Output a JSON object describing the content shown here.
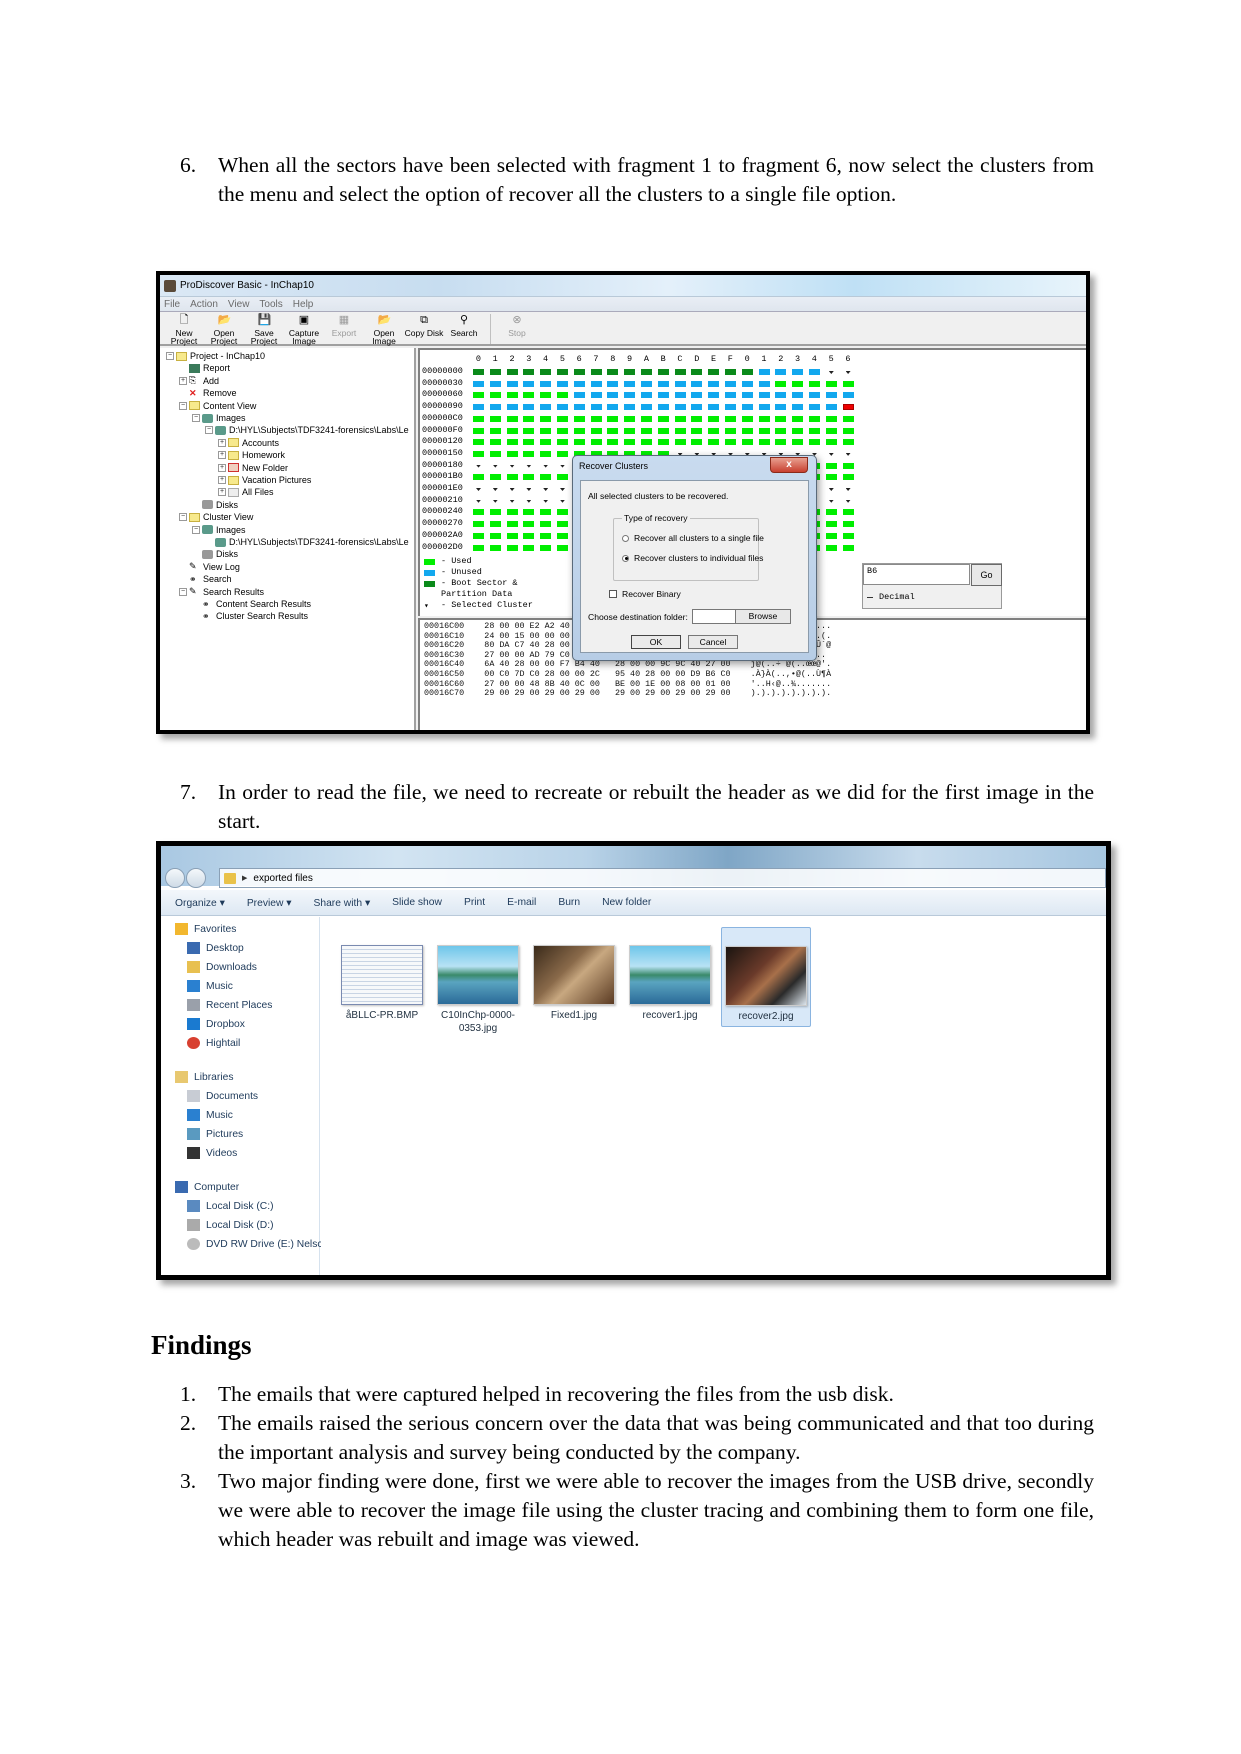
{
  "steps": [
    {
      "number": "6.",
      "text": "When all the sectors have been selected with fragment 1 to fragment 6, now select the clusters from the menu and select the option of recover all the clusters to a single file option."
    },
    {
      "number": "7.",
      "text": "In order to read the file, we need to recreate or rebuilt the header as we did for the first image in the start."
    }
  ],
  "prodiscover": {
    "window_title": "ProDiscover Basic - InChap10",
    "menu": [
      "File",
      "Action",
      "View",
      "Tools",
      "Help"
    ],
    "toolbar": [
      {
        "icon": "new-project-icon",
        "label": "New Project",
        "enabled": true
      },
      {
        "icon": "open-project-icon",
        "label": "Open Project",
        "enabled": true
      },
      {
        "icon": "save-project-icon",
        "label": "Save Project",
        "enabled": true
      },
      {
        "icon": "capture-image-icon",
        "label": "Capture Image",
        "enabled": true
      },
      {
        "icon": "export-icon",
        "label": "Export",
        "enabled": false
      },
      {
        "icon": "open-image-icon",
        "label": "Open Image",
        "enabled": true
      },
      {
        "icon": "copy-disk-icon",
        "label": "Copy Disk",
        "enabled": true
      },
      {
        "icon": "search-icon",
        "label": "Search",
        "enabled": true
      },
      {
        "icon": "stop-icon",
        "label": "Stop",
        "enabled": false
      }
    ],
    "tree": [
      {
        "level": 0,
        "expander": "-",
        "icon": "folder",
        "label": "Project - InChap10"
      },
      {
        "level": 1,
        "expander": "",
        "icon": "report",
        "label": "Report"
      },
      {
        "level": 1,
        "expander": "+",
        "icon": "add",
        "label": "Add"
      },
      {
        "level": 1,
        "expander": "",
        "icon": "remove",
        "label": "Remove"
      },
      {
        "level": 1,
        "expander": "-",
        "icon": "folder",
        "label": "Content View"
      },
      {
        "level": 2,
        "expander": "-",
        "icon": "disk",
        "label": "Images"
      },
      {
        "level": 3,
        "expander": "-",
        "icon": "disk",
        "label": "D:\\HYL\\Subjects\\TDF3241-forensics\\Labs\\Le"
      },
      {
        "level": 4,
        "expander": "+",
        "icon": "folder",
        "label": "Accounts"
      },
      {
        "level": 4,
        "expander": "+",
        "icon": "folder",
        "label": "Homework"
      },
      {
        "level": 4,
        "expander": "+",
        "icon": "folder-deleted",
        "label": "New Folder"
      },
      {
        "level": 4,
        "expander": "+",
        "icon": "folder",
        "label": "Vacation Pictures"
      },
      {
        "level": 4,
        "expander": "+",
        "icon": "folder-gray",
        "label": "All Files"
      },
      {
        "level": 2,
        "expander": "",
        "icon": "drive",
        "label": "Disks"
      },
      {
        "level": 1,
        "expander": "-",
        "icon": "folder",
        "label": "Cluster View"
      },
      {
        "level": 2,
        "expander": "-",
        "icon": "disk",
        "label": "Images"
      },
      {
        "level": 3,
        "expander": "",
        "icon": "disk",
        "label": "D:\\HYL\\Subjects\\TDF3241-forensics\\Labs\\Le"
      },
      {
        "level": 2,
        "expander": "",
        "icon": "drive",
        "label": "Disks"
      },
      {
        "level": 1,
        "expander": "",
        "icon": "log",
        "label": "View Log"
      },
      {
        "level": 1,
        "expander": "",
        "icon": "binoculars",
        "label": "Search"
      },
      {
        "level": 1,
        "expander": "-",
        "icon": "log",
        "label": "Search Results"
      },
      {
        "level": 2,
        "expander": "",
        "icon": "binoculars",
        "label": "Content Search Results"
      },
      {
        "level": 2,
        "expander": "",
        "icon": "binoculars",
        "label": "Cluster Search Results"
      }
    ],
    "cluster_grid": {
      "column_headers": [
        "0",
        "1",
        "2",
        "3",
        "4",
        "5",
        "6",
        "7",
        "8",
        "9",
        "A",
        "B",
        "C",
        "D",
        "E",
        "F",
        "0",
        "1",
        "2",
        "3",
        "4",
        "5",
        "6"
      ],
      "row_addresses": [
        "00000000",
        "00000030",
        "00000060",
        "00000090",
        "000000C0",
        "000000F0",
        "00000120",
        "00000150",
        "00000180",
        "000001B0",
        "000001E0",
        "00000210",
        "00000240",
        "00000270",
        "000002A0",
        "000002D0"
      ],
      "legend": [
        {
          "state": "used",
          "label": "- Used"
        },
        {
          "state": "unused",
          "label": "- Unused"
        },
        {
          "state": "boot",
          "label": "- Boot Sector &"
        },
        {
          "state": "",
          "label": "  Partition Data"
        },
        {
          "state": "sel",
          "label": "- Selected Cluster"
        }
      ],
      "colors": {
        "used": "#00ee00",
        "unused": "#12a8ee",
        "boot": "#0a8a1a",
        "bad": "#ee0000"
      }
    },
    "goto": {
      "value": "B6",
      "go_label": "Go",
      "decimal_label": "Decimal"
    },
    "hex_dump": [
      "00016C00    28 00 00 E2 A2 40 40 00   00 00 00 00 00 00 00 00    (..âḉ@@.........",
      "00016C10    24 00 15 00 00 00 00 00   00 00 00 00 00 00 28 28    $.............(.",
      "00016C20    80 DA C7 40 28 00 00 DA   BA C0 28 00 00 DB B4 40    €ÚÇ@(..ÚºÀ(..Û´@",
      "00016C30    27 00 00 AD 79 C0 27 00   00 C0 6C 40 27 00 00 00    '..­yÀ'..Àl@'...",
      "00016C40    6A 40 28 00 00 F7 B4 40   28 00 00 9C 9C 40 27 00    j@(..÷´@(..œœ@'.",
      "00016C50    00 C0 7D C0 28 00 00 2C   95 40 28 00 00 D9 B6 C0    .À}À(..,•@(..Ù¶À",
      "00016C60    27 00 00 48 8B 40 0C 00   BE 00 1E 00 08 00 01 00    '..H‹@..¾.......",
      "00016C70    29 00 29 00 29 00 29 00   29 00 29 00 29 00 29 00    ).).).).).).).)."
    ],
    "dialog": {
      "title": "Recover Clusters",
      "close_label": "x",
      "info": "All selected clusters to be recovered.",
      "group_label": "Type of recovery",
      "options": [
        {
          "label": "Recover all clusters to a single file",
          "selected": false
        },
        {
          "label": "Recover clusters to individual files",
          "selected": true
        }
      ],
      "recover_binary_label": "Recover Binary",
      "recover_binary_checked": false,
      "destination_label": "Choose destination folder:",
      "destination_value": "",
      "browse_label": "Browse",
      "ok_label": "OK",
      "cancel_label": "Cancel"
    }
  },
  "explorer": {
    "address": "exported files",
    "commands": [
      "Organize ▾",
      "Preview ▾",
      "Share with ▾",
      "Slide show",
      "Print",
      "E-mail",
      "Burn",
      "New folder"
    ],
    "sidebar": [
      {
        "label": "Favorites",
        "icon": "star-icon",
        "header": true
      },
      {
        "label": "Desktop",
        "icon": "desktop-icon"
      },
      {
        "label": "Downloads",
        "icon": "downloads-icon"
      },
      {
        "label": "Music",
        "icon": "music-icon"
      },
      {
        "label": "Recent Places",
        "icon": "recent-places-icon"
      },
      {
        "label": "Dropbox",
        "icon": "dropbox-icon"
      },
      {
        "label": "Hightail",
        "icon": "hightail-icon"
      },
      {
        "label": "Libraries",
        "icon": "libraries-icon",
        "header": true
      },
      {
        "label": "Documents",
        "icon": "documents-icon"
      },
      {
        "label": "Music",
        "icon": "music-icon"
      },
      {
        "label": "Pictures",
        "icon": "pictures-icon"
      },
      {
        "label": "Videos",
        "icon": "videos-icon"
      },
      {
        "label": "Computer",
        "icon": "computer-icon",
        "header": true
      },
      {
        "label": "Local Disk (C:)",
        "icon": "local-disk-c-icon"
      },
      {
        "label": "Local Disk (D:)",
        "icon": "local-disk-d-icon"
      },
      {
        "label": "DVD RW Drive (E:) Nelsc",
        "icon": "dvd-drive-icon"
      }
    ],
    "files": [
      {
        "name": "åBLLC-PR.BMP",
        "thumb": "doc",
        "selected": false
      },
      {
        "name": "C10InChp-0000-0353.jpg",
        "thumb": "sea",
        "selected": false
      },
      {
        "name": "Fixed1.jpg",
        "thumb": "wood",
        "selected": false
      },
      {
        "name": "recover1.jpg",
        "thumb": "sea",
        "selected": false
      },
      {
        "name": "recover2.jpg",
        "thumb": "dark",
        "selected": true
      }
    ]
  },
  "findings": {
    "heading": "Findings",
    "items": [
      {
        "number": "1.",
        "text": "The emails that were captured helped in recovering the files from the usb disk."
      },
      {
        "number": "2.",
        "text": "The emails raised the serious concern over the data that was being communicated and that too during the important analysis and survey being conducted by the company."
      },
      {
        "number": "3.",
        "text": "Two major finding were done, first we were able to recover the images from the USB drive, secondly we were able to recover the image file using the cluster tracing and combining them to form one file, which header was rebuilt and image was viewed."
      }
    ]
  }
}
